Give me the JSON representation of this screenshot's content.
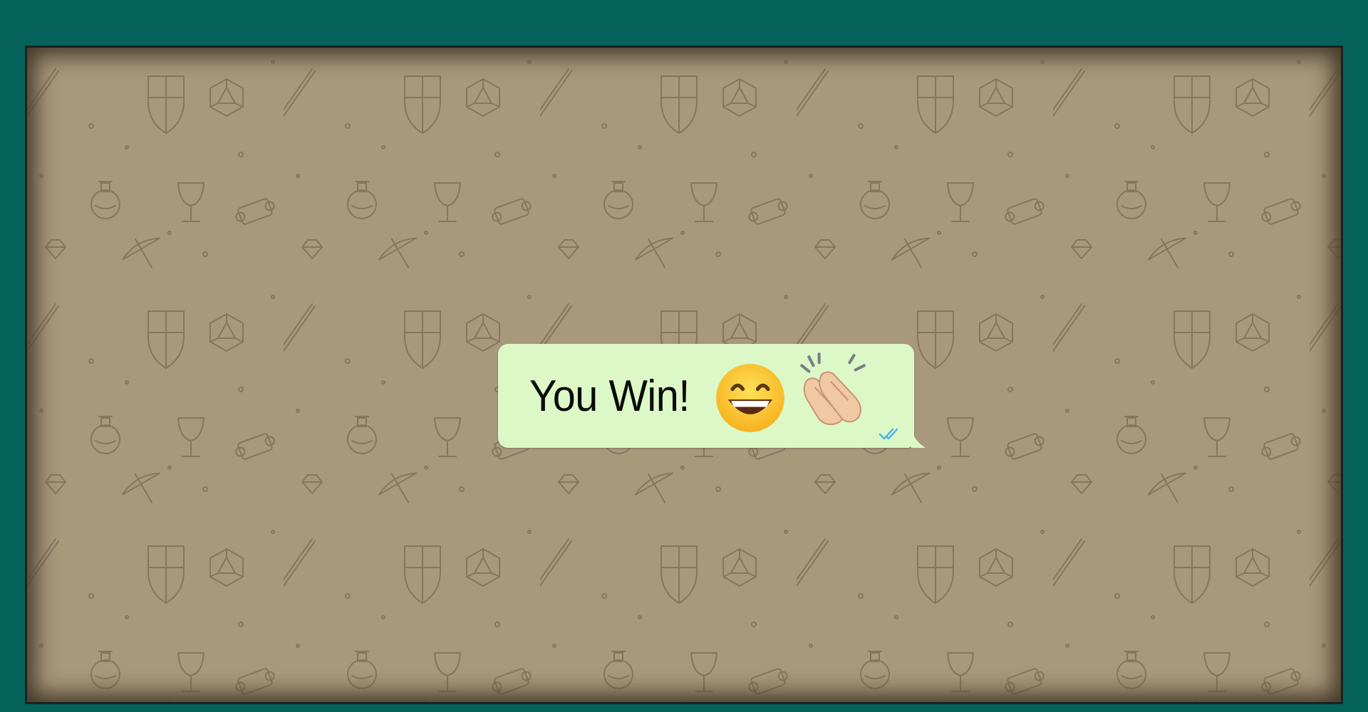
{
  "message": {
    "text": "You Win!",
    "emojis": [
      "grinning-face-with-smiling-eyes",
      "clapping-hands"
    ],
    "status": "read",
    "bubble_color": "#dcf8c6",
    "tick_color": "#4fb6ec"
  },
  "colors": {
    "outer_background": "#05635b",
    "wallpaper": "#a8987c",
    "wallpaper_doodle": "#7a6a52"
  },
  "wallpaper_icons": [
    "sword-icon",
    "shield-icon",
    "d20-die-icon",
    "potion-icon",
    "chalice-icon",
    "scroll-icon",
    "gem-icon",
    "bow-icon"
  ]
}
